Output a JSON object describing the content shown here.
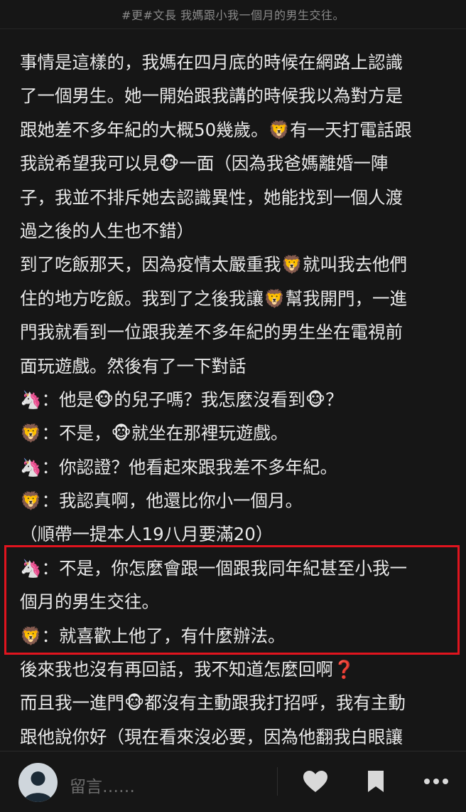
{
  "header": {
    "title": "#更#文長 我媽跟小我一個月的男生交往。"
  },
  "post": {
    "lines": [
      "事情是這樣的，我媽在四月底的時候在網路上認識",
      "了一個男生。她一開始跟我講的時候我以為對方是",
      "跟她差不多年紀的大概50幾歲。🦁有一天打電話跟",
      "我說希望我可以見🐵一面（因為我爸媽離婚一陣",
      "子，我並不排斥她去認識異性，她能找到一個人渡",
      "過之後的人生也不錯）",
      "到了吃飯那天，因為疫情太嚴重我🦁就叫我去他們",
      "住的地方吃飯。我到了之後我讓🦁幫我開門，一進",
      "門我就看到一位跟我差不多年紀的男生坐在電視前",
      "面玩遊戲。然後有了一下對話",
      "🦄：他是🐵的兒子嗎？我怎麼沒看到🐵？",
      "🦁：不是，🐵就坐在那裡玩遊戲。",
      "🦄：你認證？他看起來跟我差不多年紀。",
      "🦁：我認真啊，他還比你小一個月。",
      "（順帶一提本人19八月要滿20）",
      "🦄：不是，你怎麼會跟一個跟我同年紀甚至小我一",
      "個月的男生交往。",
      "🦁：就喜歡上他了，有什麼辦法。",
      "後來我也沒有再回話，我不知道怎麼回啊❓",
      "而且我一進門🐵都沒有主動跟我打招呼，我有主動",
      "跟他說你好（現在看來沒必要，因為他翻我白眼讓"
    ]
  },
  "bottombar": {
    "comment_placeholder": "留言……",
    "avatar_icon": "user-avatar-icon",
    "like_icon": "heart-icon",
    "save_icon": "bookmark-icon",
    "more_icon": "more-icon"
  },
  "colors": {
    "background": "#161616",
    "text": "#e8e8e8",
    "highlight": "#e0141e",
    "icon": "#d9d9d9"
  }
}
